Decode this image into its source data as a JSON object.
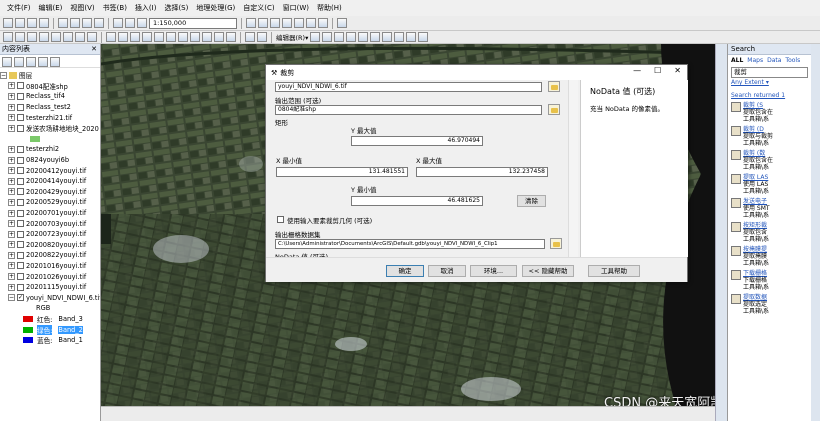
{
  "menu": [
    "文件(F)",
    "编辑(E)",
    "视图(V)",
    "书签(B)",
    "插入(I)",
    "选择(S)",
    "地理处理(G)",
    "自定义(C)",
    "窗口(W)",
    "帮助(H)"
  ],
  "toolbar": {
    "scale": "1:150,000",
    "editor_label": "编辑器(R)▾"
  },
  "toc": {
    "title": "内容列表",
    "close": "✕",
    "layers_root": "图层",
    "layers": [
      {
        "name": "0804配准shp",
        "checked": false
      },
      {
        "name": "Reclass_tif4",
        "checked": false
      },
      {
        "name": "Reclass_test2",
        "checked": false
      },
      {
        "name": "testerzhi21.tif",
        "checked": false
      },
      {
        "name": "发送农场耕地地块_2020",
        "checked": false
      },
      {
        "name": "testerzhi2",
        "checked": false
      },
      {
        "name": "0824youyi6b",
        "checked": false
      },
      {
        "name": "20200412youyi.tif",
        "checked": false
      },
      {
        "name": "20200414youyi.tif",
        "checked": false
      },
      {
        "name": "20200429youyi.tif",
        "checked": false
      },
      {
        "name": "20200529youyi.tif",
        "checked": false
      },
      {
        "name": "20200701youyi.tif",
        "checked": false
      },
      {
        "name": "20200703youyi.tif",
        "checked": false
      },
      {
        "name": "20200723youyi.tif",
        "checked": false
      },
      {
        "name": "20200820youyi.tif",
        "checked": false
      },
      {
        "name": "20200822youyi.tif",
        "checked": false
      },
      {
        "name": "20201016youyi.tif",
        "checked": false
      },
      {
        "name": "20201026youyi.tif",
        "checked": false
      },
      {
        "name": "20201115youyi.tif",
        "checked": false
      },
      {
        "name": "youyi_NDVI_NDWI_6.tif",
        "checked": true
      }
    ],
    "rgb_label": "RGB",
    "bands": [
      {
        "label": "红色:",
        "band": "Band_3",
        "color": "#e00000"
      },
      {
        "label": "绿色:",
        "band": "Band_2",
        "color": "#00b000",
        "highlight": true
      },
      {
        "label": "蓝色:",
        "band": "Band_1",
        "color": "#0000e0"
      }
    ]
  },
  "dialog": {
    "title": "裁剪",
    "input_raster": "youyi_NDVI_NDWI_6.tif",
    "extent_label": "输出范围 (可选)",
    "extent_value": "0804配准shp",
    "rect_label": "矩形",
    "ymax_label": "Y 最大值",
    "ymax": "46.970494",
    "xmin_label": "X 最小值",
    "xmin": "131.481551",
    "xmax_label": "X 最大值",
    "xmax": "132.237458",
    "ymin_label": "Y 最小值",
    "ymin": "46.481625",
    "clear_button": "清除",
    "use_geometry_label": "使用输入要素裁剪几何 (可选)",
    "output_label": "输出栅格数据集",
    "output_value": "C:\\Users\\Administrator\\Documents\\ArcGIS\\Default.gdb\\youyi_NDVI_NDWI_6_Clip1",
    "nodata_label": "NoData 值 (可选)",
    "help_title": "NoData 值 (可选)",
    "help_text": "充当 NoData 的像素值。",
    "buttons": {
      "ok": "确定",
      "cancel": "取消",
      "env": "环境...",
      "hide_help": "<< 隐藏帮助",
      "tool_help": "工具帮助"
    }
  },
  "search": {
    "title": "Search",
    "tabs": [
      "ALL",
      "Maps",
      "Data",
      "Tools"
    ],
    "query": "裁剪",
    "advanced": "Any Extent ▾",
    "status": "Search returned 1",
    "results": [
      {
        "title": "裁剪 (S",
        "l1": "提取包含在",
        "l2": "工具箱\\系"
      },
      {
        "title": "裁剪 (D",
        "l1": "提取与裁剪",
        "l2": "工具箱\\系"
      },
      {
        "title": "裁剪 (数",
        "l1": "提取包含在",
        "l2": "工具箱\\系"
      },
      {
        "title": "提取 LAS",
        "l1": "使用 LAS",
        "l2": "工具箱\\系"
      },
      {
        "title": "发送电子",
        "l1": "使用 SMT",
        "l2": "工具箱\\系"
      },
      {
        "title": "按矩形裁",
        "l1": "提取包含",
        "l2": "工具箱\\系"
      },
      {
        "title": "按掩膜提",
        "l1": "提取掩膜",
        "l2": "工具箱\\系"
      },
      {
        "title": "下载栅格",
        "l1": "下载栅格",
        "l2": "工具箱\\系"
      },
      {
        "title": "提取数据",
        "l1": "提取选定",
        "l2": "工具箱\\系"
      }
    ]
  },
  "watermark": "CSDN @来天宽阿凯慕芋泥"
}
